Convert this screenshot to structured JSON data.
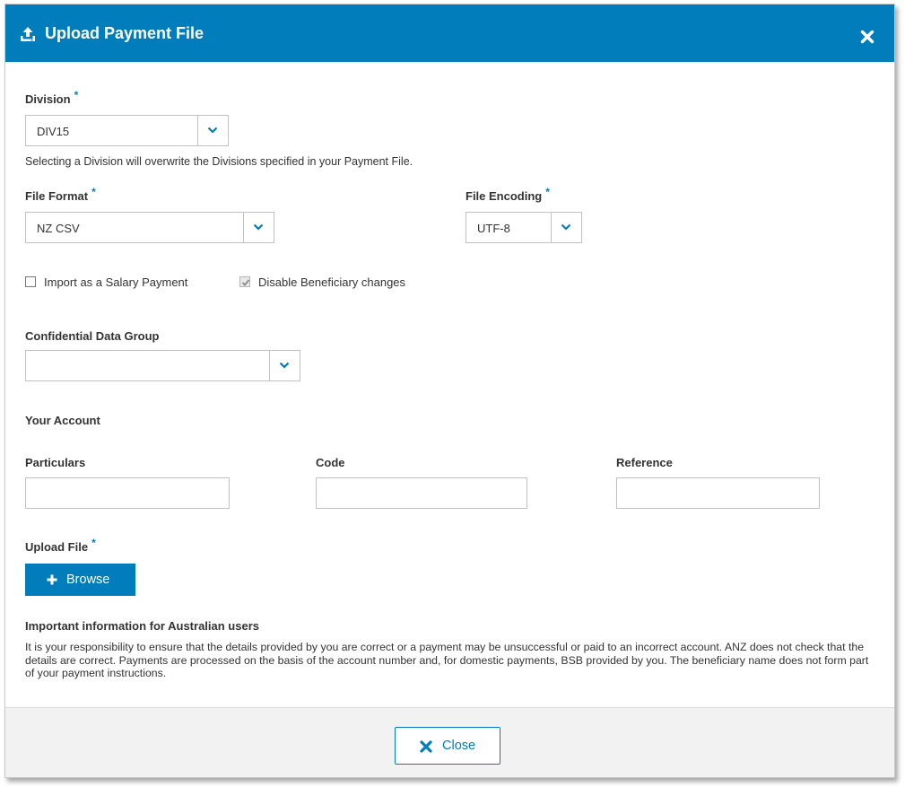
{
  "header": {
    "title": "Upload Payment File",
    "icon": "upload-icon",
    "close_icon": "close-icon"
  },
  "division": {
    "label": "Division",
    "required": "*",
    "value": "DIV15",
    "help": "Selecting a Division will overwrite the Divisions specified in your Payment File."
  },
  "file_format": {
    "label": "File Format",
    "required": "*",
    "value": "NZ CSV"
  },
  "file_encoding": {
    "label": "File Encoding",
    "required": "*",
    "value": "UTF-8"
  },
  "checkboxes": {
    "salary": {
      "label": "Import as a Salary Payment",
      "checked": false
    },
    "beneficiary": {
      "label": "Disable Beneficiary changes",
      "checked": true,
      "disabled": true
    }
  },
  "confidential": {
    "label": "Confidential Data Group",
    "value": ""
  },
  "your_account": {
    "label": "Your Account"
  },
  "particulars": {
    "label": "Particulars",
    "value": ""
  },
  "code": {
    "label": "Code",
    "value": ""
  },
  "reference": {
    "label": "Reference",
    "value": ""
  },
  "upload": {
    "label": "Upload File",
    "required": "*",
    "browse_label": "Browse"
  },
  "info": {
    "title": "Important information for Australian users",
    "body": "It is your responsibility to ensure that the details provided by you are correct or a payment may be unsuccessful or paid to an incorrect account. ANZ does not check that the details are correct. Payments are processed on the basis of the account number and, for domestic payments, BSB provided by you. The beneficiary name does not form part of your payment instructions."
  },
  "footer": {
    "close_label": "Close"
  },
  "colors": {
    "brand": "#007dba",
    "footer_bg": "#f2f2f2"
  }
}
